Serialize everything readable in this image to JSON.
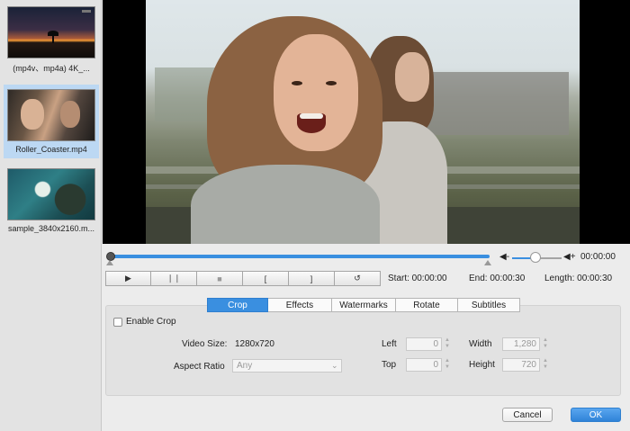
{
  "sidebar": {
    "items": [
      {
        "label": "(mp4v、mp4a)  4K_..."
      },
      {
        "label": "Roller_Coaster.mp4"
      },
      {
        "label": "sample_3840x2160.m..."
      }
    ]
  },
  "player": {
    "progress": 0.0,
    "current_time": "00:00:00",
    "volume": 0.5,
    "volume_low_icon": "speaker-low-icon",
    "volume_high_icon": "speaker-high-icon"
  },
  "transport": {
    "play": "▶",
    "pause": "❙❙",
    "stop": "■",
    "mark_in": "[",
    "mark_out": "]",
    "reset": "↺"
  },
  "times": {
    "start": "Start: 00:00:00",
    "end": "End: 00:00:30",
    "length": "Length: 00:00:30"
  },
  "tabs": [
    {
      "label": "Crop",
      "active": true
    },
    {
      "label": "Effects",
      "active": false
    },
    {
      "label": "Watermarks",
      "active": false
    },
    {
      "label": "Rotate",
      "active": false
    },
    {
      "label": "Subtitles",
      "active": false
    }
  ],
  "crop": {
    "enable_label": "Enable Crop",
    "enabled": false,
    "video_size_label": "Video Size:",
    "video_size_value": "1280x720",
    "aspect_ratio_label": "Aspect Ratio",
    "aspect_ratio_value": "Any",
    "left_label": "Left",
    "left_value": "0",
    "top_label": "Top",
    "top_value": "0",
    "width_label": "Width",
    "width_value": "1,280",
    "height_label": "Height",
    "height_value": "720"
  },
  "footer": {
    "cancel_label": "Cancel",
    "ok_label": "OK"
  },
  "colors": {
    "accent": "#3a8fe0",
    "selection": "#bcd8f3"
  }
}
